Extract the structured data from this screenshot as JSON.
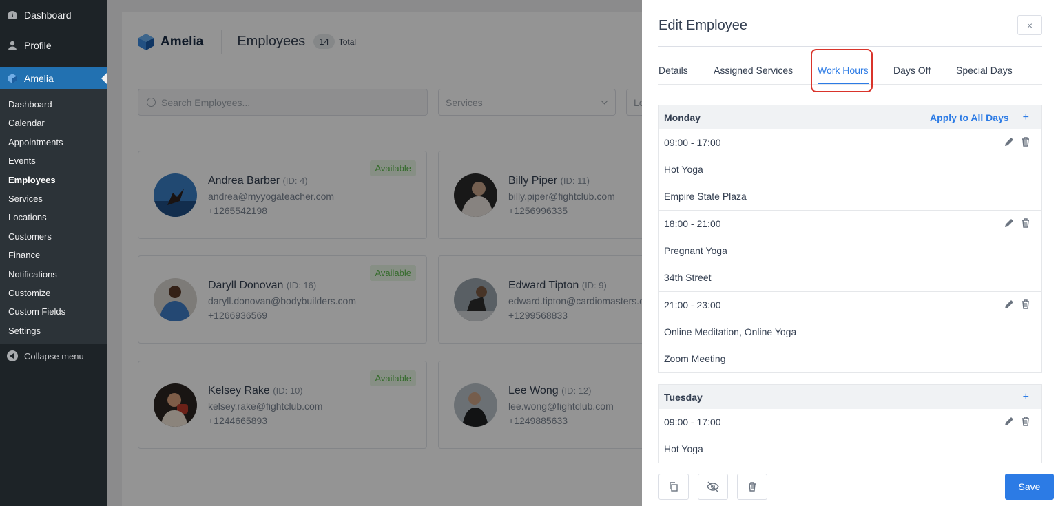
{
  "wp_menu": {
    "dashboard": "Dashboard",
    "profile": "Profile",
    "amelia": "Amelia",
    "sub": [
      "Dashboard",
      "Calendar",
      "Appointments",
      "Events",
      "Employees",
      "Services",
      "Locations",
      "Customers",
      "Finance",
      "Notifications",
      "Customize",
      "Custom Fields",
      "Settings"
    ],
    "active": "Employees",
    "collapse": "Collapse menu"
  },
  "header": {
    "brand": "Amelia",
    "title": "Employees",
    "count": "14",
    "count_label": "Total"
  },
  "filters": {
    "search_placeholder": "Search Employees...",
    "services_placeholder": "Services",
    "locations_placeholder": "Lo"
  },
  "employees": [
    {
      "name": "Andrea Barber",
      "id": "(ID: 4)",
      "email": "andrea@myyogateacher.com",
      "phone": "+1265542198",
      "status": "Available"
    },
    {
      "name": "Billy Piper",
      "id": "(ID: 11)",
      "email": "billy.piper@fightclub.com",
      "phone": "+1256996335",
      "status": ""
    },
    {
      "name": "Daryll Donovan",
      "id": "(ID: 16)",
      "email": "daryll.donovan@bodybuilders.com",
      "phone": "+1266936569",
      "status": "Available"
    },
    {
      "name": "Edward Tipton",
      "id": "(ID: 9)",
      "email": "edward.tipton@cardiomasters.co",
      "phone": "+1299568833",
      "status": ""
    },
    {
      "name": "Kelsey Rake",
      "id": "(ID: 10)",
      "email": "kelsey.rake@fightclub.com",
      "phone": "+1244665893",
      "status": "Available"
    },
    {
      "name": "Lee Wong",
      "id": "(ID: 12)",
      "email": "lee.wong@fightclub.com",
      "phone": "+1249885633",
      "status": ""
    }
  ],
  "drawer": {
    "title": "Edit Employee",
    "close": "×",
    "tabs": [
      "Details",
      "Assigned Services",
      "Work Hours",
      "Days Off",
      "Special Days"
    ],
    "active_tab": "Work Hours",
    "apply_all": "Apply to All Days",
    "plus": "+",
    "days": [
      {
        "name": "Monday",
        "periods": [
          {
            "time": "09:00 - 17:00",
            "services": "Hot Yoga",
            "location": "Empire State Plaza"
          },
          {
            "time": "18:00 - 21:00",
            "services": "Pregnant Yoga",
            "location": "34th Street"
          },
          {
            "time": "21:00 - 23:00",
            "services": "Online Meditation, Online Yoga",
            "location": "Zoom Meeting"
          }
        ]
      },
      {
        "name": "Tuesday",
        "periods": [
          {
            "time": "09:00 - 17:00",
            "services": "Hot Yoga",
            "location": ""
          }
        ]
      }
    ],
    "save": "Save"
  },
  "colors": {
    "accent": "#2c7be5",
    "wp_sidebar": "#1d2327",
    "wp_active": "#2271b1",
    "available": "#5bb84a",
    "highlight": "#d9342b"
  }
}
